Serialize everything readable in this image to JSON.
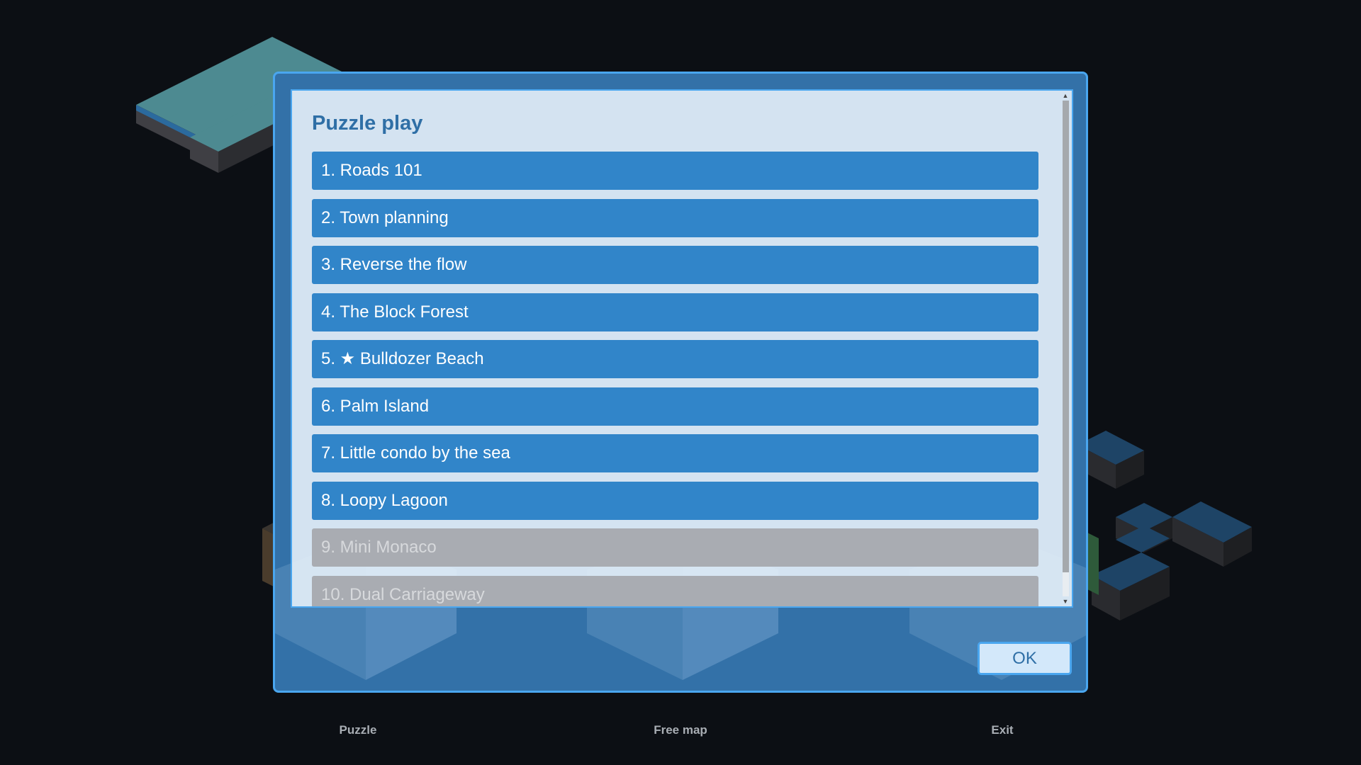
{
  "dialog": {
    "title": "Puzzle play",
    "ok_label": "OK",
    "levels": [
      {
        "label": "1. Roads 101",
        "locked": false
      },
      {
        "label": "2. Town planning",
        "locked": false
      },
      {
        "label": "3. Reverse the flow",
        "locked": false
      },
      {
        "label": "4. The Block Forest",
        "locked": false
      },
      {
        "label": "5. ★ Bulldozer Beach",
        "locked": false
      },
      {
        "label": "6. Palm Island",
        "locked": false
      },
      {
        "label": "7. Little condo by the sea",
        "locked": false
      },
      {
        "label": "8. Loopy Lagoon",
        "locked": false
      },
      {
        "label": "9. Mini Monaco",
        "locked": true
      },
      {
        "label": "10. Dual Carriageway",
        "locked": true
      }
    ],
    "scroll_up_icon": "scroll-up-arrow-icon",
    "scroll_down_icon": "scroll-down-arrow-icon"
  },
  "menu": {
    "puzzle_label": "Puzzle",
    "free_map_label": "Free map",
    "exit_label": "Exit"
  },
  "colors": {
    "background": "#0c0f14",
    "dialog": "#3371a8",
    "dialog_border": "#4aa6ef",
    "level_button": "#3185c9",
    "level_locked": "#a9acb2",
    "title": "#2f6fa6"
  }
}
